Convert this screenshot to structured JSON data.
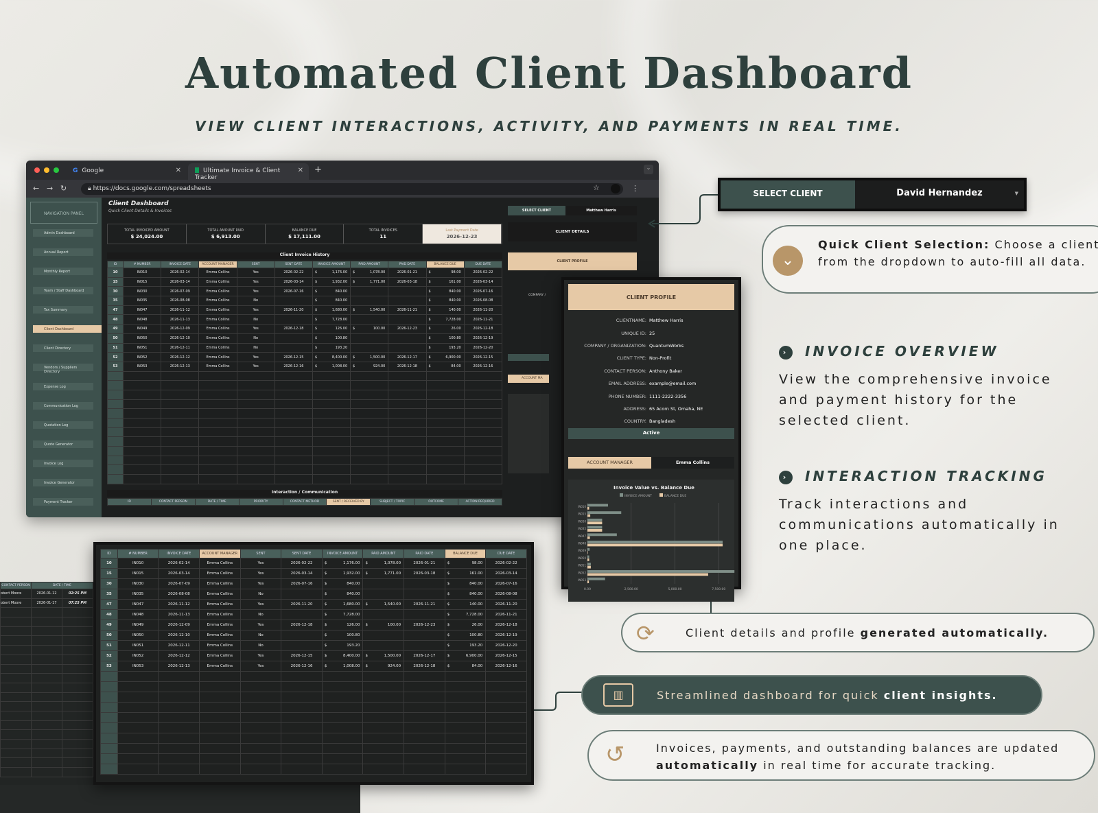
{
  "hero": {
    "title": "Automated Client Dashboard",
    "subtitle": "VIEW CLIENT INTERACTIONS, ACTIVITY, AND PAYMENTS IN REAL TIME."
  },
  "browser": {
    "tabs": [
      {
        "label": "Google"
      },
      {
        "label": "Ultimate Invoice & Client Tracker"
      }
    ],
    "new_tab": "+",
    "url": "https://docs.google.com/spreadsheets"
  },
  "sidebar": {
    "header": "NAVIGATION PANEL",
    "items": [
      "Admin Dashboard",
      "Annual Report",
      "Monthly Report",
      "Team / Staff Dashboard",
      "Tax Summary",
      "Client Dashboard",
      "Client Directory",
      "Vendors / Suppliers Directory",
      "Expense Log",
      "Communication Log",
      "Quotation Log",
      "Quote Generator",
      "Invoice Log",
      "Invoice Generator",
      "Payment Tracker"
    ],
    "active_index": 5
  },
  "dashboard": {
    "title": "Client Dashboard",
    "subtitle": "Quick Client Details & Invoices",
    "kpis": [
      {
        "label": "TOTAL INVOICED AMOUNT",
        "value": "$ 24,024.00"
      },
      {
        "label": "TOTAL AMOUNT PAID",
        "value": "$ 6,913.00"
      },
      {
        "label": "BALANCE DUE",
        "value": "$ 17,111.00"
      },
      {
        "label": "TOTAL INVOICES",
        "value": "11"
      },
      {
        "label": "Last Payment Date",
        "value": "2026-12-23"
      }
    ],
    "invoice_history_title": "Client Invoice History",
    "interaction_title": "Interaction / Communication",
    "select_label": "SELECT CLIENT",
    "select_value": "Matthew Harris",
    "client_details": "CLIENT DETAILS",
    "client_profile": "CLIENT PROFILE",
    "account_mgr_short": "ACCOUNT MA",
    "company_short": "COMPANY /"
  },
  "invoice_table": {
    "headers": [
      "ID",
      "# NUMBER",
      "INVOICE DATE",
      "ACCOUNT MANAGER",
      "SENT",
      "SENT DATE",
      "INVOICE AMOUNT",
      "PAID AMOUNT",
      "PAID DATE",
      "BALANCE DUE",
      "DUE DATE"
    ],
    "rows": [
      [
        "10",
        "IN010",
        "2026-02-14",
        "Emma Collins",
        "Yes",
        "2026-02-22",
        "$",
        "1,176.00",
        "$",
        "1,078.00",
        "2026-01-21",
        "$",
        "98.00",
        "2026-02-22"
      ],
      [
        "15",
        "IN015",
        "2026-03-14",
        "Emma Collins",
        "Yes",
        "2026-03-14",
        "$",
        "1,932.00",
        "$",
        "1,771.00",
        "2026-03-18",
        "$",
        "161.00",
        "2026-03-14"
      ],
      [
        "30",
        "IN030",
        "2026-07-09",
        "Emma Collins",
        "Yes",
        "2026-07-16",
        "$",
        "840.00",
        "",
        "",
        "",
        "$",
        "840.00",
        "2026-07-16"
      ],
      [
        "35",
        "IN035",
        "2026-08-08",
        "Emma Collins",
        "No",
        "",
        "$",
        "840.00",
        "",
        "",
        "",
        "$",
        "840.00",
        "2026-08-08"
      ],
      [
        "47",
        "IN047",
        "2026-11-12",
        "Emma Collins",
        "Yes",
        "2026-11-20",
        "$",
        "1,680.00",
        "$",
        "1,540.00",
        "2026-11-21",
        "$",
        "140.00",
        "2026-11-20"
      ],
      [
        "48",
        "IN048",
        "2026-11-13",
        "Emma Collins",
        "No",
        "",
        "$",
        "7,728.00",
        "",
        "",
        "",
        "$",
        "7,728.00",
        "2026-11-21"
      ],
      [
        "49",
        "IN049",
        "2026-12-09",
        "Emma Collins",
        "Yes",
        "2026-12-18",
        "$",
        "126.00",
        "$",
        "100.00",
        "2026-12-23",
        "$",
        "26.00",
        "2026-12-18"
      ],
      [
        "50",
        "IN050",
        "2026-12-10",
        "Emma Collins",
        "No",
        "",
        "$",
        "100.80",
        "",
        "",
        "",
        "$",
        "100.80",
        "2026-12-19"
      ],
      [
        "51",
        "IN051",
        "2026-12-11",
        "Emma Collins",
        "No",
        "",
        "$",
        "193.20",
        "",
        "",
        "",
        "$",
        "193.20",
        "2026-12-20"
      ],
      [
        "52",
        "IN052",
        "2026-12-12",
        "Emma Collins",
        "Yes",
        "2026-12-15",
        "$",
        "8,400.00",
        "$",
        "1,500.00",
        "2026-12-17",
        "$",
        "6,900.00",
        "2026-12-15"
      ],
      [
        "53",
        "IN053",
        "2026-12-13",
        "Emma Collins",
        "Yes",
        "2026-12-16",
        "$",
        "1,008.00",
        "$",
        "924.00",
        "2026-12-18",
        "$",
        "84.00",
        "2026-12-16"
      ]
    ]
  },
  "interaction_headers": [
    "ID",
    "CONTACT PERSON",
    "DATE / TIME",
    "PRIORITY",
    "CONTACT METHOD",
    "SENT / RECEIVED BY",
    "SUBJECT / TOPIC",
    "OUTCOME",
    "ACTION REQUIRED"
  ],
  "left_fragment": {
    "headers": [
      "CONTACT PERSON",
      "DATE / TIME"
    ],
    "rows": [
      [
        "obert Moore",
        "2026-01-12",
        "02:25 PM"
      ],
      [
        "obert Moore",
        "2026-01-17",
        "07:25 PM"
      ]
    ]
  },
  "profile": {
    "header": "CLIENT PROFILE",
    "fields": [
      {
        "k": "CLIENTNAME:",
        "v": "Matthew Harris"
      },
      {
        "k": "UNIQUE ID:",
        "v": "25"
      },
      {
        "k": "COMPANY / ORGANIZATION:",
        "v": "QuantumWorks"
      },
      {
        "k": "CLIENT TYPE:",
        "v": "Non-Profit"
      },
      {
        "k": "CONTACT PERSON:",
        "v": "Anthony Baker"
      },
      {
        "k": "EMAIL ADDRESS:",
        "v": "example@email.com"
      },
      {
        "k": "PHONE NUMBER:",
        "v": "1111-2222-3356"
      },
      {
        "k": "ADDRESS:",
        "v": "65 Acorn St, Omaha, NE"
      },
      {
        "k": "COUNTRY:",
        "v": "Bangladesh"
      }
    ],
    "status": "Active",
    "account_manager_label": "ACCOUNT MANAGER",
    "account_manager": "Emma Collins"
  },
  "chart_data": {
    "type": "bar",
    "orientation": "horizontal",
    "title": "Invoice Value vs. Balance Due",
    "categories": [
      "IN010",
      "IN015",
      "IN030",
      "IN035",
      "IN047",
      "IN048",
      "IN049",
      "IN050",
      "IN051",
      "IN052",
      "IN053"
    ],
    "series": [
      {
        "name": "INVOICE AMOUNT",
        "color": "#7f8f88",
        "values": [
          1176,
          1932,
          840,
          840,
          1680,
          7728,
          126,
          100.8,
          193.2,
          8400,
          1008
        ]
      },
      {
        "name": "BALANCE DUE",
        "color": "#e6c9a6",
        "values": [
          98,
          161,
          840,
          840,
          140,
          7728,
          26,
          100.8,
          193.2,
          6900,
          84
        ]
      }
    ],
    "xlim": [
      0,
      8000
    ],
    "xticks": [
      "0.00",
      "2,500.00",
      "5,000.00",
      "7,500.00"
    ],
    "legend": "top",
    "grid": true
  },
  "select_box": {
    "label": "SELECT CLIENT",
    "value": "David Hernandez"
  },
  "quick": {
    "icon": "chevron-down",
    "bold": "Quick Client Selection:",
    "text": " Choose a client from the dropdown to auto-fill all data."
  },
  "features": [
    {
      "title": "INVOICE OVERVIEW",
      "text": "View the comprehensive invoice and payment history for the selected client."
    },
    {
      "title": "INTERACTION TRACKING",
      "text": "Track interactions and communications automatically in one place."
    }
  ],
  "callouts": {
    "c1": {
      "text": "Client details and profile ",
      "bold": "generated automatically."
    },
    "c2": {
      "text": "Streamlined dashboard for quick ",
      "bold": "client insights."
    },
    "c3": {
      "text1": "Invoices, payments, and outstanding balances are updated ",
      "bold": "automatically",
      "text2": " in real time for accurate tracking."
    }
  }
}
